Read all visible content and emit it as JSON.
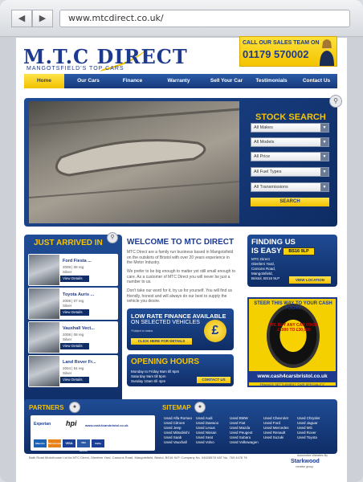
{
  "browser": {
    "url": "www.mtcdirect.co.uk/",
    "back_icon": "back-arrow-icon",
    "forward_icon": "forward-arrow-icon"
  },
  "header": {
    "logo_title": "M.T.C DIRECT",
    "logo_subtitle": "MANGOTSFIELD'S TOP CARS",
    "call_label": "CALL OUR SALES TEAM ON",
    "phone": "01179 570002"
  },
  "menu": [
    "Home",
    "Our Cars",
    "Finance",
    "Warranty",
    "Sell Your Car",
    "Testimonials",
    "Contact Us"
  ],
  "stock_search": {
    "title": "STOCK SEARCH",
    "fields": [
      "All Makes",
      "All Models",
      "All Price",
      "All Fuel Types",
      "All Transmissions"
    ],
    "button": "SEARCH"
  },
  "just_arrived": {
    "title": "JUST ARRIVED IN",
    "details_label": "View Details",
    "cars": [
      {
        "name": "Ford Fiesta ...",
        "info1": "2008 | 08 reg",
        "info2": "Silver"
      },
      {
        "name": "Toyota Auris ...",
        "info1": "2008 | 07 reg",
        "info2": "Silver"
      },
      {
        "name": "Vauxhall Vect...",
        "info1": "2008 | 08 reg",
        "info2": "Silver"
      },
      {
        "name": "Land Rover Fr...",
        "info1": "2004 | 54 reg",
        "info2": "Silver"
      }
    ]
  },
  "welcome": {
    "title": "WELCOME TO MTC DIRECT",
    "p1": "MTC Direct are a family run business based in Mangotsfield on the outskirts of Bristol with over 20 years experience in the Motor Industry.",
    "p2": "We prefer to be big enough to matter yet still small enough to care. As a customer of MTC Direct you will never be just a number to us.",
    "p3": "Don't take our word for it, try us for yourself. You will find us friendly, honest and will always do our best to supply the vehicle you desire."
  },
  "low_rate": {
    "line1": "LOW RATE FINANCE AVAILABLE",
    "line2": "ON SELECTED VEHICLES",
    "note": "*Subject to status",
    "button": "CLICK HERE FOR DETAILS",
    "icon": "pound-icon"
  },
  "opening": {
    "title": "OPENING HOURS",
    "hours": [
      "Monday to Friday 9am till 6pm",
      "Saturday 9am till 5pm",
      "Sunday 10am till 4pm"
    ],
    "button": "CONTACT US"
  },
  "finding": {
    "title": "FINDING US IS EASY",
    "address": [
      "MTC Direct",
      "Glenfern Yard,",
      "Carsons Road,",
      "Mangotsfield,",
      "Bristol, BS16 9LP"
    ],
    "plate": "BS16 9LP",
    "button": "VIEW LOCATION"
  },
  "promo": {
    "headline": "STEER THIS WAY TO YOUR CASH TODAY",
    "middle": "WE BUY ANY CAR FROM £1000 TO £30,000",
    "url": "www.cash4carsbristol.co.uk",
    "tagline": "FINANCE SETTLEMENT 'OUR SPECIALITY'"
  },
  "partners": {
    "title": "PARTNERS",
    "logos": [
      "Experian",
      "hpi",
      "www.cash4carsbristol.co.uk"
    ],
    "cards": [
      "Maestro",
      "Mastercard",
      "VISA",
      "VISA Electron",
      "Delta"
    ]
  },
  "sitemap": {
    "title": "SITEMAP",
    "columns": [
      [
        "Used Alfa Romeo",
        "Used Citroen",
        "Used Jeep",
        "Used Mitsubishi",
        "Used Saab",
        "Used Vauxhall"
      ],
      [
        "Used Audi",
        "Used Daewoo",
        "Used Lexus",
        "Used Nissan",
        "Used Seat",
        "Used Volvo"
      ],
      [
        "Used BMW",
        "Used Fiat",
        "Used Mazda",
        "Used Peugeot",
        "Used Subaru",
        "Used Volkswagen"
      ],
      [
        "Used Chevrolet",
        "Used Ford",
        "Used Mercedes",
        "Used Renault",
        "Used Suzuki"
      ],
      [
        "Used Chrysler",
        "Used Jaguar",
        "Used MG",
        "Used Rover",
        "Used Toyota"
      ]
    ]
  },
  "footer": {
    "text": "Bath Road Motorhouse Ltd t/a MTC Direct, Glenfern Yard, Carsons Road, Mangotsfield, Bristol, BS16 9LP. Company No. 04628578 VAT No. 763 4478 76",
    "credit1": "Automotive Websites By",
    "credit2": "Starkwood",
    "credit3": "creative group"
  },
  "colors": {
    "brand_blue": "#1d3a8f",
    "accent_yellow": "#f7c400"
  }
}
